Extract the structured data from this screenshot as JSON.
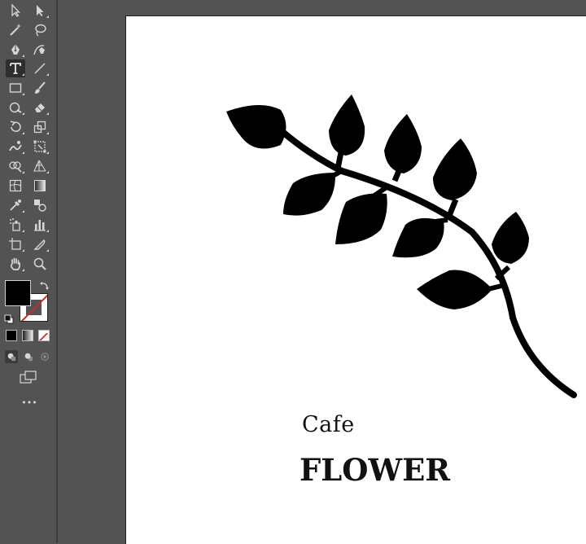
{
  "canvas": {
    "artboard_color": "#ffffff",
    "pasteboard_color": "#535353",
    "text_line_1": "Cafe",
    "text_line_2": "FLOWER"
  },
  "toolbar": {
    "active_tool": "type-tool",
    "fill_color": "#000000",
    "stroke_color": "none",
    "more_label": "•••"
  }
}
